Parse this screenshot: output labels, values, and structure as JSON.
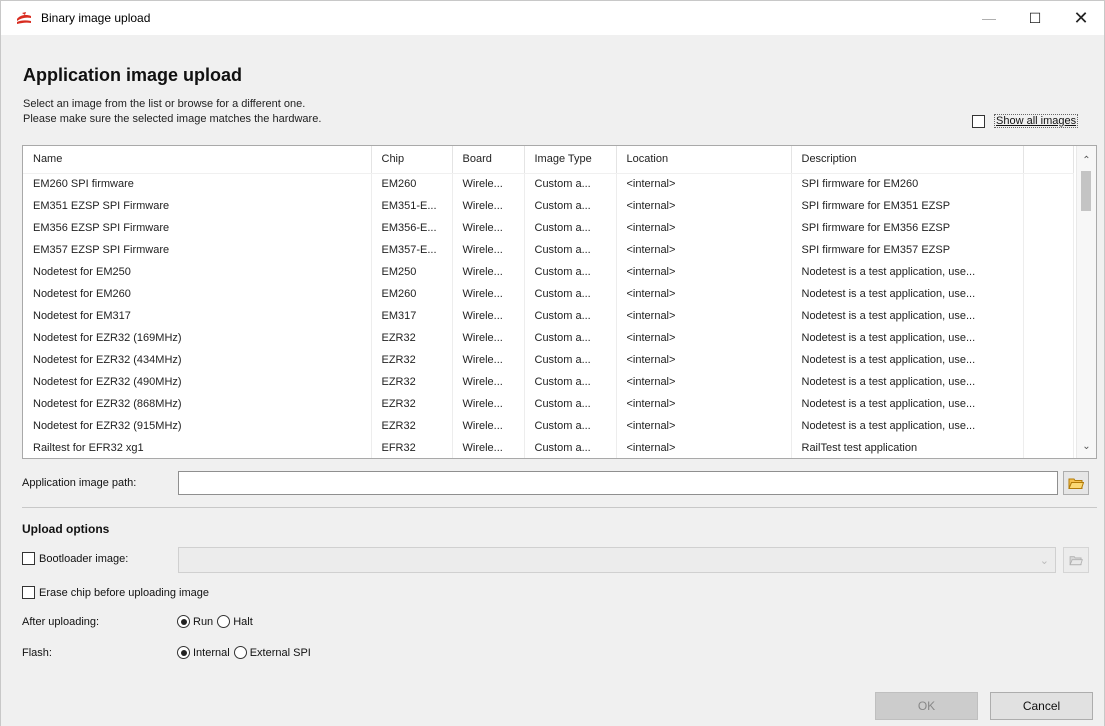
{
  "window": {
    "title": "Binary image upload",
    "minimize": "—",
    "maximize": "☐",
    "close": "✕"
  },
  "header": {
    "title": "Application image upload",
    "line1": "Select an image from the list or browse for a different one.",
    "line2": "Please make sure the selected image matches the hardware.",
    "show_all_label": "Show all images",
    "show_all_checked": false
  },
  "table": {
    "columns": [
      "Name",
      "Chip",
      "Board",
      "Image Type",
      "Location",
      "Description"
    ],
    "rows": [
      [
        "EM260 SPI firmware",
        "EM260",
        "Wirele...",
        "Custom a...",
        "<internal>",
        "SPI firmware for EM260"
      ],
      [
        "EM351 EZSP SPI Firmware",
        "EM351-E...",
        "Wirele...",
        "Custom a...",
        "<internal>",
        "SPI firmware for EM351 EZSP"
      ],
      [
        "EM356 EZSP SPI Firmware",
        "EM356-E...",
        "Wirele...",
        "Custom a...",
        "<internal>",
        "SPI firmware for EM356 EZSP"
      ],
      [
        "EM357 EZSP SPI Firmware",
        "EM357-E...",
        "Wirele...",
        "Custom a...",
        "<internal>",
        "SPI firmware for EM357 EZSP"
      ],
      [
        "Nodetest for EM250",
        "EM250",
        "Wirele...",
        "Custom a...",
        "<internal>",
        "Nodetest is a test application, use..."
      ],
      [
        "Nodetest for EM260",
        "EM260",
        "Wirele...",
        "Custom a...",
        "<internal>",
        "Nodetest is a test application, use..."
      ],
      [
        "Nodetest for EM317",
        "EM317",
        "Wirele...",
        "Custom a...",
        "<internal>",
        "Nodetest is a test application, use..."
      ],
      [
        "Nodetest for EZR32 (169MHz)",
        "EZR32",
        "Wirele...",
        "Custom a...",
        "<internal>",
        "Nodetest is a test application, use..."
      ],
      [
        "Nodetest for EZR32 (434MHz)",
        "EZR32",
        "Wirele...",
        "Custom a...",
        "<internal>",
        "Nodetest is a test application, use..."
      ],
      [
        "Nodetest for EZR32 (490MHz)",
        "EZR32",
        "Wirele...",
        "Custom a...",
        "<internal>",
        "Nodetest is a test application, use..."
      ],
      [
        "Nodetest for EZR32 (868MHz)",
        "EZR32",
        "Wirele...",
        "Custom a...",
        "<internal>",
        "Nodetest is a test application, use..."
      ],
      [
        "Nodetest for EZR32 (915MHz)",
        "EZR32",
        "Wirele...",
        "Custom a...",
        "<internal>",
        "Nodetest is a test application, use..."
      ],
      [
        "Railtest for EFR32 xg1",
        "EFR32",
        "Wirele...",
        "Custom a...",
        "<internal>",
        "RailTest test application"
      ]
    ]
  },
  "path": {
    "label": "Application image path:",
    "value": ""
  },
  "upload_options": {
    "title": "Upload options",
    "bootloader_label": "Bootloader image:",
    "bootloader_checked": false,
    "bootloader_value": "",
    "erase_label": "Erase chip before uploading image",
    "erase_checked": false,
    "after_label": "After uploading:",
    "after_options": [
      "Run",
      "Halt"
    ],
    "after_selected": "Run",
    "flash_label": "Flash:",
    "flash_options": [
      "Internal",
      "External SPI"
    ],
    "flash_selected": "Internal"
  },
  "buttons": {
    "ok": "OK",
    "cancel": "Cancel"
  },
  "colors": {
    "window_bg": "#f0f0f0",
    "ok_disabled_bg": "#cccccc",
    "folder_icon": "#e8a317"
  }
}
